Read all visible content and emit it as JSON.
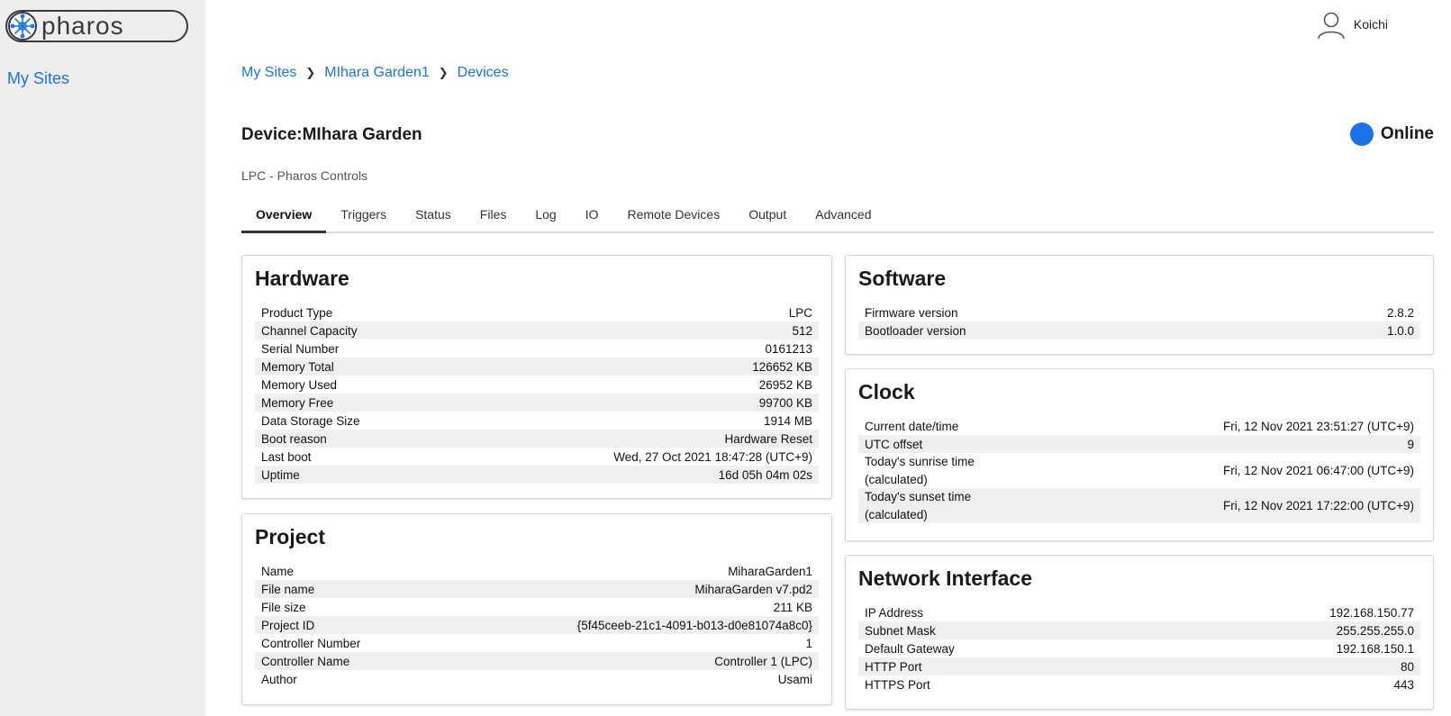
{
  "app": {
    "brand": "pharos"
  },
  "sidebar": {
    "my_sites": "My Sites"
  },
  "user": {
    "name": "Koichi"
  },
  "breadcrumb": [
    "My Sites",
    "MIhara Garden1",
    "Devices"
  ],
  "device": {
    "label": "Device:",
    "name": "MIhara Garden",
    "status": "Online",
    "subtitle": "LPC - Pharos Controls"
  },
  "tabs": [
    "Overview",
    "Triggers",
    "Status",
    "Files",
    "Log",
    "IO",
    "Remote Devices",
    "Output",
    "Advanced"
  ],
  "hardware": {
    "title": "Hardware",
    "rows": [
      {
        "key": "Product Type",
        "value": "LPC"
      },
      {
        "key": "Channel Capacity",
        "value": "512"
      },
      {
        "key": "Serial Number",
        "value": "0161213"
      },
      {
        "key": "Memory Total",
        "value": "126652 KB"
      },
      {
        "key": "Memory Used",
        "value": "26952 KB"
      },
      {
        "key": "Memory Free",
        "value": "99700 KB"
      },
      {
        "key": "Data Storage Size",
        "value": "1914 MB"
      },
      {
        "key": "Boot reason",
        "value": "Hardware Reset"
      },
      {
        "key": "Last boot",
        "value": "Wed, 27 Oct 2021 18:47:28 (UTC+9)"
      },
      {
        "key": "Uptime",
        "value": "16d 05h 04m 02s"
      }
    ]
  },
  "project": {
    "title": "Project",
    "rows": [
      {
        "key": "Name",
        "value": "MiharaGarden1"
      },
      {
        "key": "File name",
        "value": "MiharaGarden v7.pd2"
      },
      {
        "key": "File size",
        "value": "211 KB"
      },
      {
        "key": "Project ID",
        "value": "{5f45ceeb-21c1-4091-b013-d0e81074a8c0}"
      },
      {
        "key": "Controller Number",
        "value": "1"
      },
      {
        "key": "Controller Name",
        "value": "Controller 1 (LPC)"
      },
      {
        "key": "Author",
        "value": "Usami"
      }
    ]
  },
  "software": {
    "title": "Software",
    "rows": [
      {
        "key": "Firmware version",
        "value": "2.8.2"
      },
      {
        "key": "Bootloader version",
        "value": "1.0.0"
      }
    ]
  },
  "clock": {
    "title": "Clock",
    "rows": [
      {
        "key": "Current date/time",
        "value": "Fri, 12 Nov 2021 23:51:27 (UTC+9)"
      },
      {
        "key": "UTC offset",
        "value": "9"
      },
      {
        "key": "Today's sunrise time",
        "key2": "(calculated)",
        "value": "Fri, 12 Nov 2021 06:47:00 (UTC+9)"
      },
      {
        "key": "Today's sunset time",
        "key2": "(calculated)",
        "value": "Fri, 12 Nov 2021 17:22:00 (UTC+9)"
      }
    ]
  },
  "network": {
    "title": "Network Interface",
    "rows": [
      {
        "key": "IP Address",
        "value": "192.168.150.77"
      },
      {
        "key": "Subnet Mask",
        "value": "255.255.255.0"
      },
      {
        "key": "Default Gateway",
        "value": "192.168.150.1"
      },
      {
        "key": "HTTP Port",
        "value": "80"
      },
      {
        "key": "HTTPS Port",
        "value": "443"
      }
    ]
  },
  "colors": {
    "accent": "#1a73e8",
    "status_online": "#1a73e8",
    "sidebar_bg": "#eeeeee",
    "row_stripe": "#efefef"
  },
  "icons": [
    "pharos-logo",
    "user-avatar-icon",
    "chevron-right-icon",
    "status-dot-icon"
  ]
}
